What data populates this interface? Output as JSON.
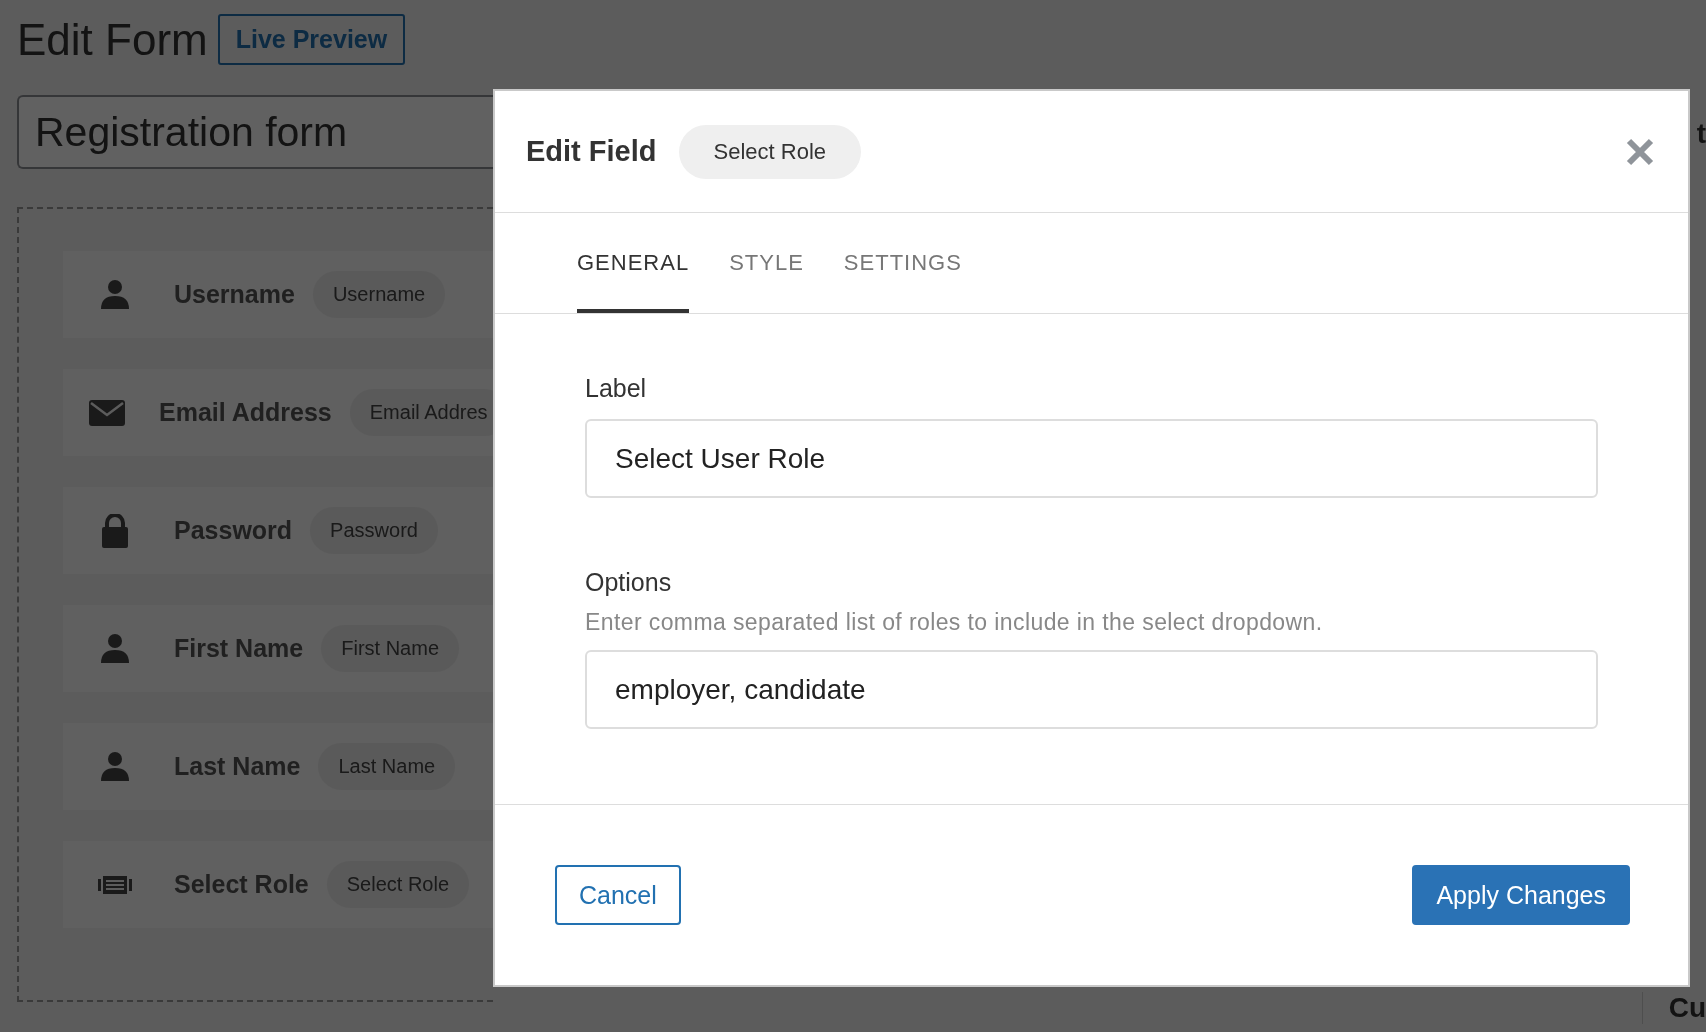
{
  "page": {
    "title": "Edit Form",
    "preview_button": "Live Preview",
    "form_name": "Registration form",
    "fields": [
      {
        "kind": "user",
        "label": "Username",
        "tag": "Username"
      },
      {
        "kind": "email",
        "label": "Email Address",
        "tag": "Email Addres"
      },
      {
        "kind": "lock",
        "label": "Password",
        "tag": "Password"
      },
      {
        "kind": "user",
        "label": "First Name",
        "tag": "First Name"
      },
      {
        "kind": "user",
        "label": "Last Name",
        "tag": "Last Name"
      },
      {
        "kind": "select",
        "label": "Select Role",
        "tag": "Select Role"
      }
    ],
    "side_panel": {
      "heading": "t",
      "footer": "Cu"
    }
  },
  "modal": {
    "title": "Edit Field",
    "badge": "Select Role",
    "tabs": [
      {
        "label": "GENERAL",
        "selected": true
      },
      {
        "label": "STYLE",
        "selected": false
      },
      {
        "label": "SETTINGS",
        "selected": false
      }
    ],
    "label_field": {
      "label": "Label",
      "value": "Select User Role"
    },
    "options_field": {
      "label": "Options",
      "help": "Enter comma separated list of roles to include in the select dropdown.",
      "value": "employer, candidate"
    },
    "buttons": [
      {
        "kind": "secondary",
        "label": "Cancel"
      },
      {
        "kind": "primary",
        "label": "Apply Changes"
      }
    ]
  }
}
